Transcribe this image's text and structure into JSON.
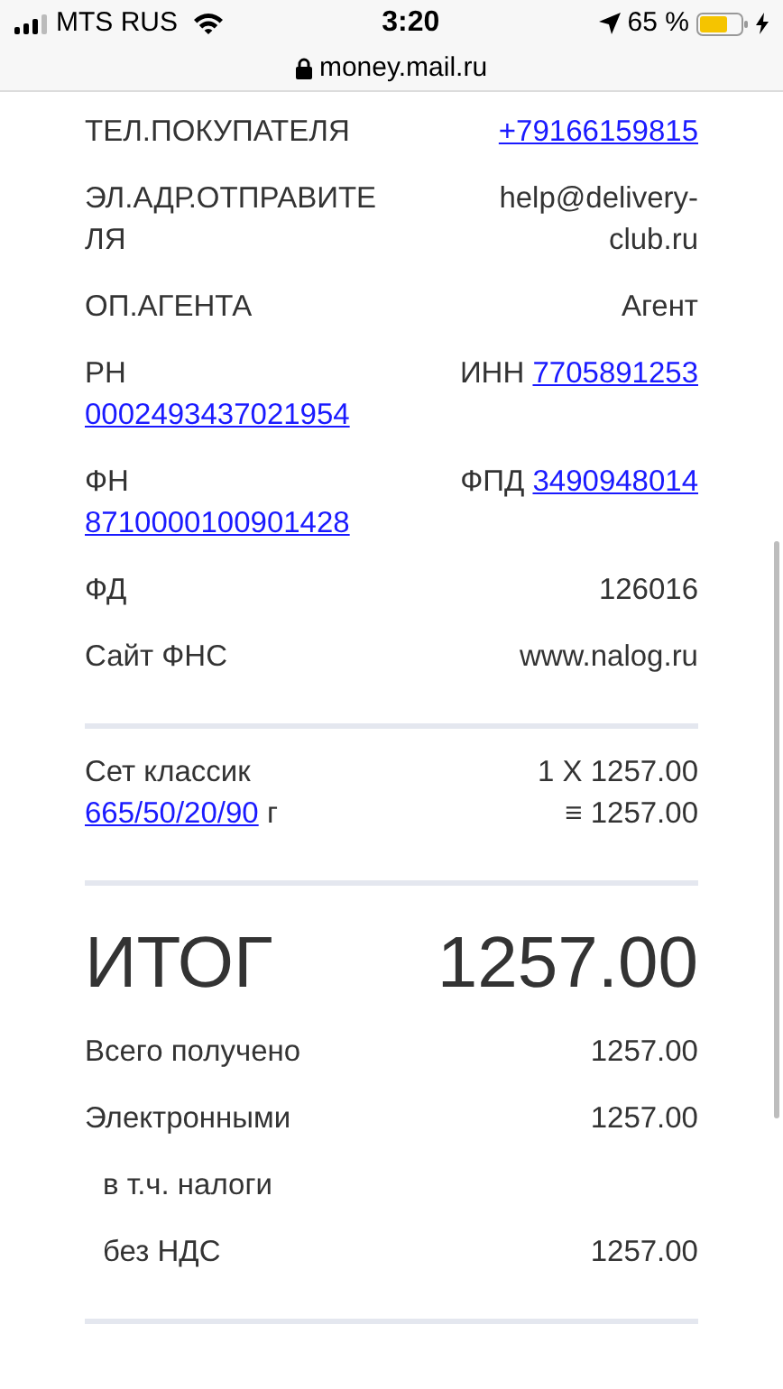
{
  "status_bar": {
    "carrier": "MTS RUS",
    "time": "3:20",
    "battery": "65 %"
  },
  "address_bar": {
    "url": "money.mail.ru"
  },
  "sections": [
    {
      "rows": [
        {
          "kind": "pair",
          "left": [
            {
              "text": "ТЕЛ.ПОКУПАТЕЛЯ",
              "link": false
            }
          ],
          "right": [
            {
              "text": "+79166159815",
              "link": true
            }
          ]
        },
        {
          "kind": "pair",
          "left": [
            {
              "text": "ЭЛ.АДР.ОТПРАВИТЕЛЯ",
              "link": false
            }
          ],
          "right": [
            {
              "text": "help@delivery-club.ru",
              "link": false
            }
          ]
        },
        {
          "kind": "pair",
          "left": [
            {
              "text": "ОП.АГЕНТА",
              "link": false
            }
          ],
          "right": [
            {
              "text": "Агент",
              "link": false
            }
          ]
        },
        {
          "kind": "pair",
          "left": [
            {
              "text": "РН",
              "link": false
            },
            {
              "text": "0002493437021954",
              "link": true
            }
          ],
          "right": [
            {
              "text": "ИНН",
              "link": false
            },
            {
              "text": "7705891253",
              "link": true
            }
          ]
        },
        {
          "kind": "pair",
          "left": [
            {
              "text": "ФН",
              "link": false
            },
            {
              "text": "8710000100901428",
              "link": true
            }
          ],
          "right": [
            {
              "text": "ФПД",
              "link": false
            },
            {
              "text": "3490948014",
              "link": true
            }
          ]
        },
        {
          "kind": "pair",
          "left": [
            {
              "text": "ФД",
              "link": false
            }
          ],
          "right": [
            {
              "text": "126016",
              "link": false
            }
          ]
        },
        {
          "kind": "pair",
          "left": [
            {
              "text": "Сайт ФНС",
              "link": false
            }
          ],
          "right": [
            {
              "text": "www.nalog.ru",
              "link": false
            }
          ]
        }
      ]
    },
    {
      "rows": [
        {
          "kind": "item",
          "left": [
            {
              "text": "Сет классик",
              "link": false
            },
            {
              "text": "665/50/20/90",
              "link": true
            },
            {
              "text": "г",
              "link": false
            }
          ],
          "right": [
            {
              "text": "1 X 1257.00",
              "link": false
            },
            {
              "text": "≡ 1257.00",
              "link": false
            }
          ]
        }
      ]
    },
    {
      "rows": [
        {
          "kind": "total",
          "left": [
            {
              "text": "ИТОГ",
              "link": false
            }
          ],
          "right": [
            {
              "text": "1257.00",
              "link": false
            }
          ]
        },
        {
          "kind": "pair",
          "left": [
            {
              "text": "Всего получено",
              "link": false
            }
          ],
          "right": [
            {
              "text": "1257.00",
              "link": false
            }
          ]
        },
        {
          "kind": "pair",
          "left": [
            {
              "text": "Электронными",
              "link": false
            }
          ],
          "right": [
            {
              "text": "1257.00",
              "link": false
            }
          ]
        },
        {
          "kind": "sub",
          "left": [
            {
              "text": "в т.ч. налоги",
              "link": false
            }
          ],
          "right": []
        },
        {
          "kind": "sub",
          "left": [
            {
              "text": "без НДС",
              "link": false
            }
          ],
          "right": [
            {
              "text": "1257.00",
              "link": false
            }
          ]
        }
      ]
    }
  ]
}
